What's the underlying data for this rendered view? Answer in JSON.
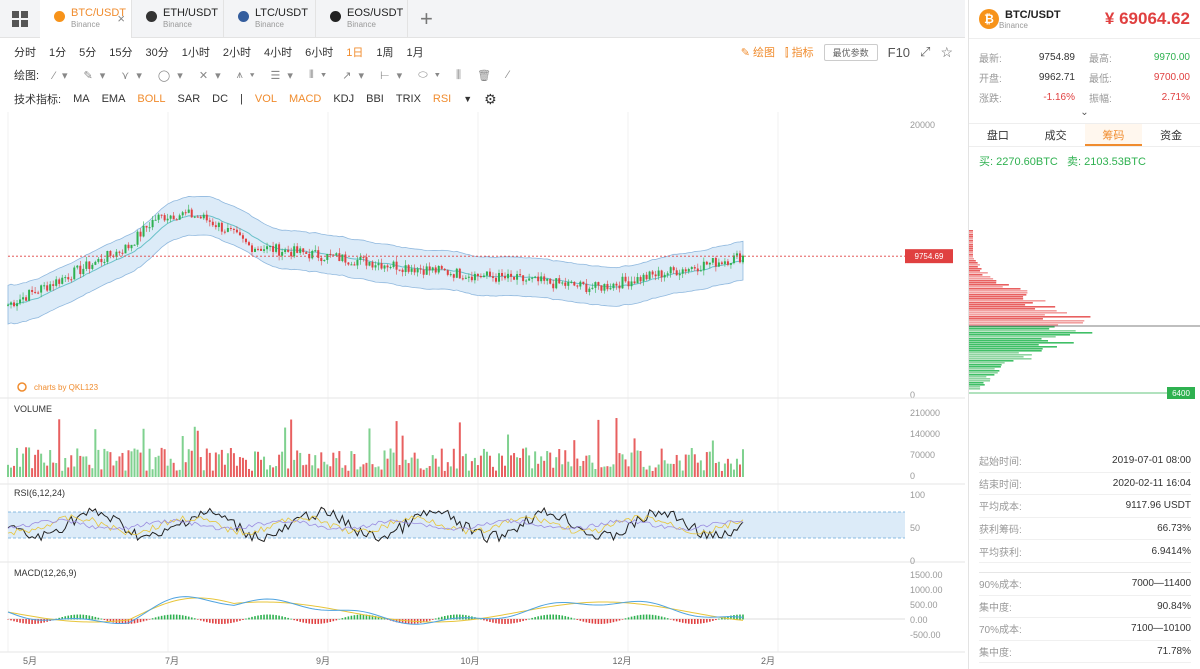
{
  "tabs": [
    {
      "symbol": "BTC/USDT",
      "exchange": "Binance",
      "icon": "bitcoin-icon",
      "color": "#f7931a"
    },
    {
      "symbol": "ETH/USDT",
      "exchange": "Binance",
      "icon": "ethereum-icon",
      "color": "#333333"
    },
    {
      "symbol": "LTC/USDT",
      "exchange": "Binance",
      "icon": "litecoin-icon",
      "color": "#345d9d"
    },
    {
      "symbol": "EOS/USDT",
      "exchange": "Binance",
      "icon": "eos-icon",
      "color": "#222222"
    }
  ],
  "timeframes": [
    "分时",
    "1分",
    "5分",
    "15分",
    "30分",
    "1小时",
    "2小时",
    "4小时",
    "6小时",
    "1日",
    "1周",
    "1月"
  ],
  "active_timeframe": "1日",
  "toolbar": {
    "draw": "绘图",
    "indicator": "指标",
    "optimize": "最优参数",
    "f10": "F10"
  },
  "draw_label": "绘图:",
  "indicators_label": "技术指标:",
  "indicators": [
    {
      "name": "MA",
      "on": false
    },
    {
      "name": "EMA",
      "on": false
    },
    {
      "name": "BOLL",
      "on": true
    },
    {
      "name": "SAR",
      "on": false
    },
    {
      "name": "DC",
      "on": false
    },
    {
      "name": "|",
      "on": false
    },
    {
      "name": "VOL",
      "on": true
    },
    {
      "name": "MACD",
      "on": true
    },
    {
      "name": "KDJ",
      "on": false
    },
    {
      "name": "BBI",
      "on": false
    },
    {
      "name": "TRIX",
      "on": false
    },
    {
      "name": "RSI",
      "on": true
    }
  ],
  "chart": {
    "watermark": "charts by QKL123",
    "price_axis": [
      "20000",
      "0"
    ],
    "current_price_tag": "9754.69",
    "volume_label": "VOLUME",
    "volume_axis": [
      "210000",
      "140000",
      "70000",
      "0"
    ],
    "rsi_label": "RSI(6,12,24)",
    "rsi_axis": [
      "100",
      "50",
      "0"
    ],
    "macd_label": "MACD(12,26,9)",
    "macd_axis": [
      "1500.00",
      "1000.00",
      "500.00",
      "0.00",
      "-500.00"
    ],
    "x_labels": [
      "5月",
      "7月",
      "9月",
      "10月",
      "12月",
      "2月"
    ],
    "depth_tag": "6400"
  },
  "chart_data": {
    "type": "line",
    "title": "",
    "x": [
      "5月",
      "7月",
      "9月",
      "10月",
      "12月",
      "2月"
    ],
    "series": [
      {
        "values": [
          6000,
          11500,
          10000,
          8500,
          7300,
          9754.69
        ]
      }
    ],
    "ylim": [
      0,
      20000
    ]
  },
  "pair": {
    "name": "BTC/USDT",
    "exchange": "Binance",
    "price": "¥ 69064.62"
  },
  "stats": [
    {
      "k": "最新:",
      "v": "9754.89",
      "k2": "最高:",
      "v2": "9970.00",
      "c2": "green"
    },
    {
      "k": "开盘:",
      "v": "9962.71",
      "k2": "最低:",
      "v2": "9700.00",
      "c2": "red"
    },
    {
      "k": "涨跌:",
      "v": "-1.16%",
      "vc": "red",
      "k2": "振幅:",
      "v2": "2.71%",
      "c2": "red"
    }
  ],
  "side_tabs": [
    "盘口",
    "成交",
    "筹码",
    "资金"
  ],
  "active_side_tab": "筹码",
  "buy": "买: 2270.60BTC",
  "sell": "卖: 2103.53BTC",
  "info1": [
    {
      "k": "起始时间:",
      "v": "2019-07-01 08:00"
    },
    {
      "k": "结束时间:",
      "v": "2020-02-11 16:04"
    },
    {
      "k": "平均成本:",
      "v": "9117.96 USDT",
      "c": "green"
    },
    {
      "k": "获利筹码:",
      "v": "66.73%"
    },
    {
      "k": "平均获利:",
      "v": "6.9414%",
      "c": "green"
    }
  ],
  "info2": [
    {
      "k": "90%成本:",
      "v": "7000—11400"
    },
    {
      "k": "集中度:",
      "v": "90.84%"
    },
    {
      "k": "70%成本:",
      "v": "7100—10100"
    },
    {
      "k": "集中度:",
      "v": "71.78%"
    }
  ]
}
